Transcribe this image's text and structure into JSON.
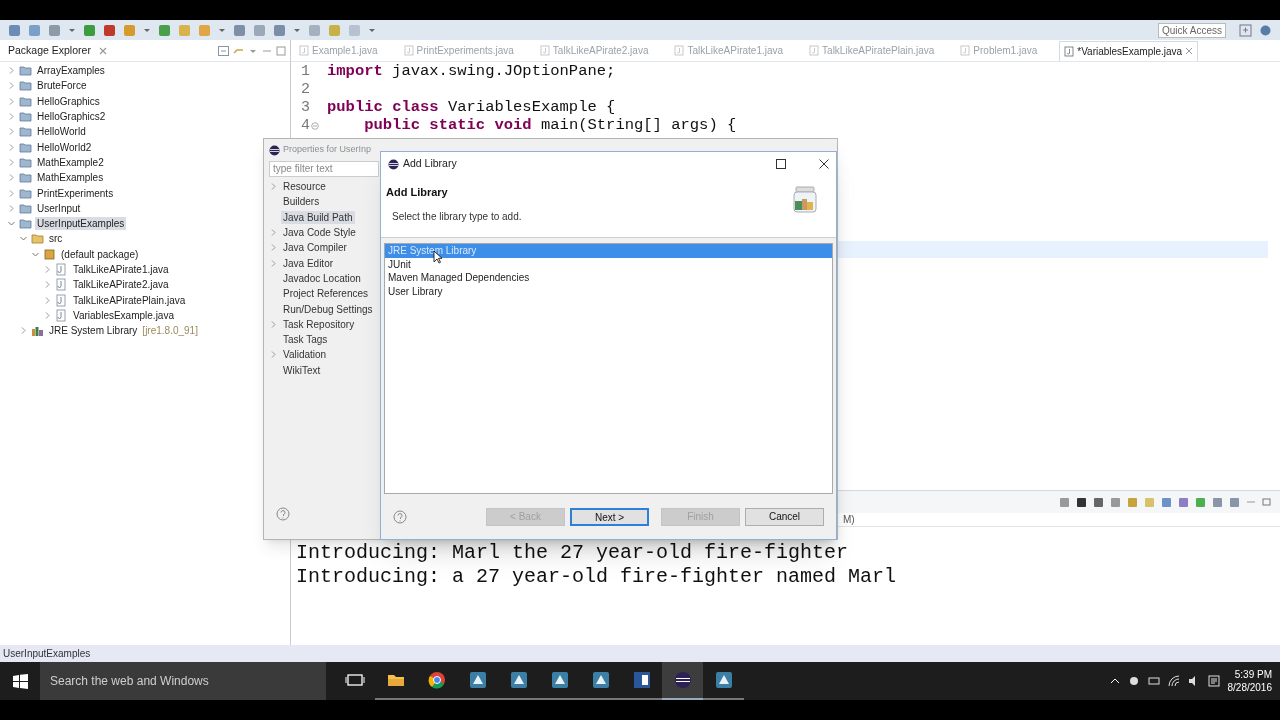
{
  "toolbar": {
    "quick_access": "Quick Access"
  },
  "package_explorer": {
    "title": "Package Explorer",
    "tree": [
      {
        "label": "ArrayExamples",
        "kind": "project",
        "expanded": false,
        "selected": false
      },
      {
        "label": "BruteForce",
        "kind": "project",
        "expanded": false,
        "selected": false
      },
      {
        "label": "HelloGraphics",
        "kind": "project",
        "expanded": false,
        "selected": false
      },
      {
        "label": "HelloGraphics2",
        "kind": "project",
        "expanded": false,
        "selected": false
      },
      {
        "label": "HelloWorld",
        "kind": "project",
        "expanded": false,
        "selected": false
      },
      {
        "label": "HelloWorld2",
        "kind": "project",
        "expanded": false,
        "selected": false
      },
      {
        "label": "MathExample2",
        "kind": "project",
        "expanded": false,
        "selected": false
      },
      {
        "label": "MathExamples",
        "kind": "project",
        "expanded": false,
        "selected": false
      },
      {
        "label": "PrintExperiments",
        "kind": "project",
        "expanded": false,
        "selected": false
      },
      {
        "label": "UserInput",
        "kind": "project",
        "expanded": false,
        "selected": false
      },
      {
        "label": "UserInputExamples",
        "kind": "project",
        "expanded": true,
        "selected": true,
        "children": [
          {
            "label": "src",
            "kind": "source-folder",
            "expanded": true,
            "selected": false,
            "children": [
              {
                "label": "(default package)",
                "kind": "package",
                "expanded": true,
                "selected": false,
                "children": [
                  {
                    "label": "TalkLikeAPirate1.java",
                    "kind": "java-file",
                    "expanded": false,
                    "selected": false
                  },
                  {
                    "label": "TalkLikeAPirate2.java",
                    "kind": "java-file",
                    "expanded": false,
                    "selected": false
                  },
                  {
                    "label": "TalkLikeAPiratePlain.java",
                    "kind": "java-file",
                    "expanded": false,
                    "selected": false
                  },
                  {
                    "label": "VariablesExample.java",
                    "kind": "java-file",
                    "expanded": false,
                    "selected": false
                  }
                ]
              }
            ]
          },
          {
            "label": "JRE System Library",
            "suffix": "[jre1.8.0_91]",
            "kind": "library",
            "expanded": false,
            "selected": false
          }
        ]
      }
    ]
  },
  "editor": {
    "tabs": [
      {
        "label": "Example1.java",
        "selected": false
      },
      {
        "label": "PrintExperiments.java",
        "selected": false
      },
      {
        "label": "TalkLikeAPirate2.java",
        "selected": false
      },
      {
        "label": "TalkLikeAPirate1.java",
        "selected": false
      },
      {
        "label": "TalkLikeAPiratePlain.java",
        "selected": false
      },
      {
        "label": "Problem1.java",
        "selected": false
      },
      {
        "label": "*VariablesExample.java",
        "selected": true
      }
    ],
    "lines": [
      {
        "number": "1",
        "code": "**import** javax.swing.JOptionPane;",
        "fold": false
      },
      {
        "number": "2",
        "fold": false
      },
      {
        "number": "3",
        "code": "**public** **class** VariablesExample {",
        "fold": false
      },
      {
        "number": "4",
        "code": "    **public** **static** **void** main(String[] args) {",
        "fold": true
      }
    ]
  },
  "console": {
    "header": "M)",
    "lines": [
      "Introducing: Marl the 27 year-old fire-fighter",
      "Introducing: a 27 year-old fire-fighter named Marl"
    ]
  },
  "status_bar": "UserInputExamples",
  "properties_dialog": {
    "title": "Properties for UserInp",
    "filter_placeholder": "type filter text",
    "items": [
      {
        "label": "Resource",
        "has_children": true,
        "selected": false
      },
      {
        "label": "Builders",
        "has_children": false,
        "selected": false
      },
      {
        "label": "Java Build Path",
        "has_children": false,
        "selected": true
      },
      {
        "label": "Java Code Style",
        "has_children": true,
        "selected": false
      },
      {
        "label": "Java Compiler",
        "has_children": true,
        "selected": false
      },
      {
        "label": "Java Editor",
        "has_children": true,
        "selected": false
      },
      {
        "label": "Javadoc Location",
        "has_children": false,
        "selected": false
      },
      {
        "label": "Project References",
        "has_children": false,
        "selected": false
      },
      {
        "label": "Run/Debug Settings",
        "has_children": false,
        "selected": false
      },
      {
        "label": "Task Repository",
        "has_children": true,
        "selected": false
      },
      {
        "label": "Task Tags",
        "has_children": false,
        "selected": false
      },
      {
        "label": "Validation",
        "has_children": true,
        "selected": false
      },
      {
        "label": "WikiText",
        "has_children": false,
        "selected": false
      }
    ]
  },
  "add_library_dialog": {
    "title": "Add Library",
    "heading": "Add Library",
    "description": "Select the library type to add.",
    "items": [
      {
        "label": "JRE System Library",
        "selected": true
      },
      {
        "label": "JUnit",
        "selected": false
      },
      {
        "label": "Maven Managed Dependencies",
        "selected": false
      },
      {
        "label": "User Library",
        "selected": false
      }
    ],
    "buttons": [
      {
        "label": "< Back",
        "disabled": true,
        "default": false
      },
      {
        "label": "Next >",
        "disabled": false,
        "default": true
      },
      {
        "label": "Finish",
        "disabled": true,
        "default": false
      },
      {
        "label": "Cancel",
        "disabled": false,
        "default": false
      }
    ]
  },
  "taskbar": {
    "search_placeholder": "Search the web and Windows",
    "apps": [
      {
        "kind": "task-view",
        "active": false
      },
      {
        "kind": "folder",
        "active": false
      },
      {
        "kind": "browser",
        "active": false
      },
      {
        "kind": "tool",
        "active": false
      },
      {
        "kind": "tool",
        "active": false
      },
      {
        "kind": "tool",
        "active": false
      },
      {
        "kind": "tool",
        "active": false
      },
      {
        "kind": "document",
        "active": false
      },
      {
        "kind": "ide",
        "active": true
      },
      {
        "kind": "tool",
        "active": false
      }
    ],
    "time": "5:39 PM",
    "date": "8/28/2016"
  }
}
